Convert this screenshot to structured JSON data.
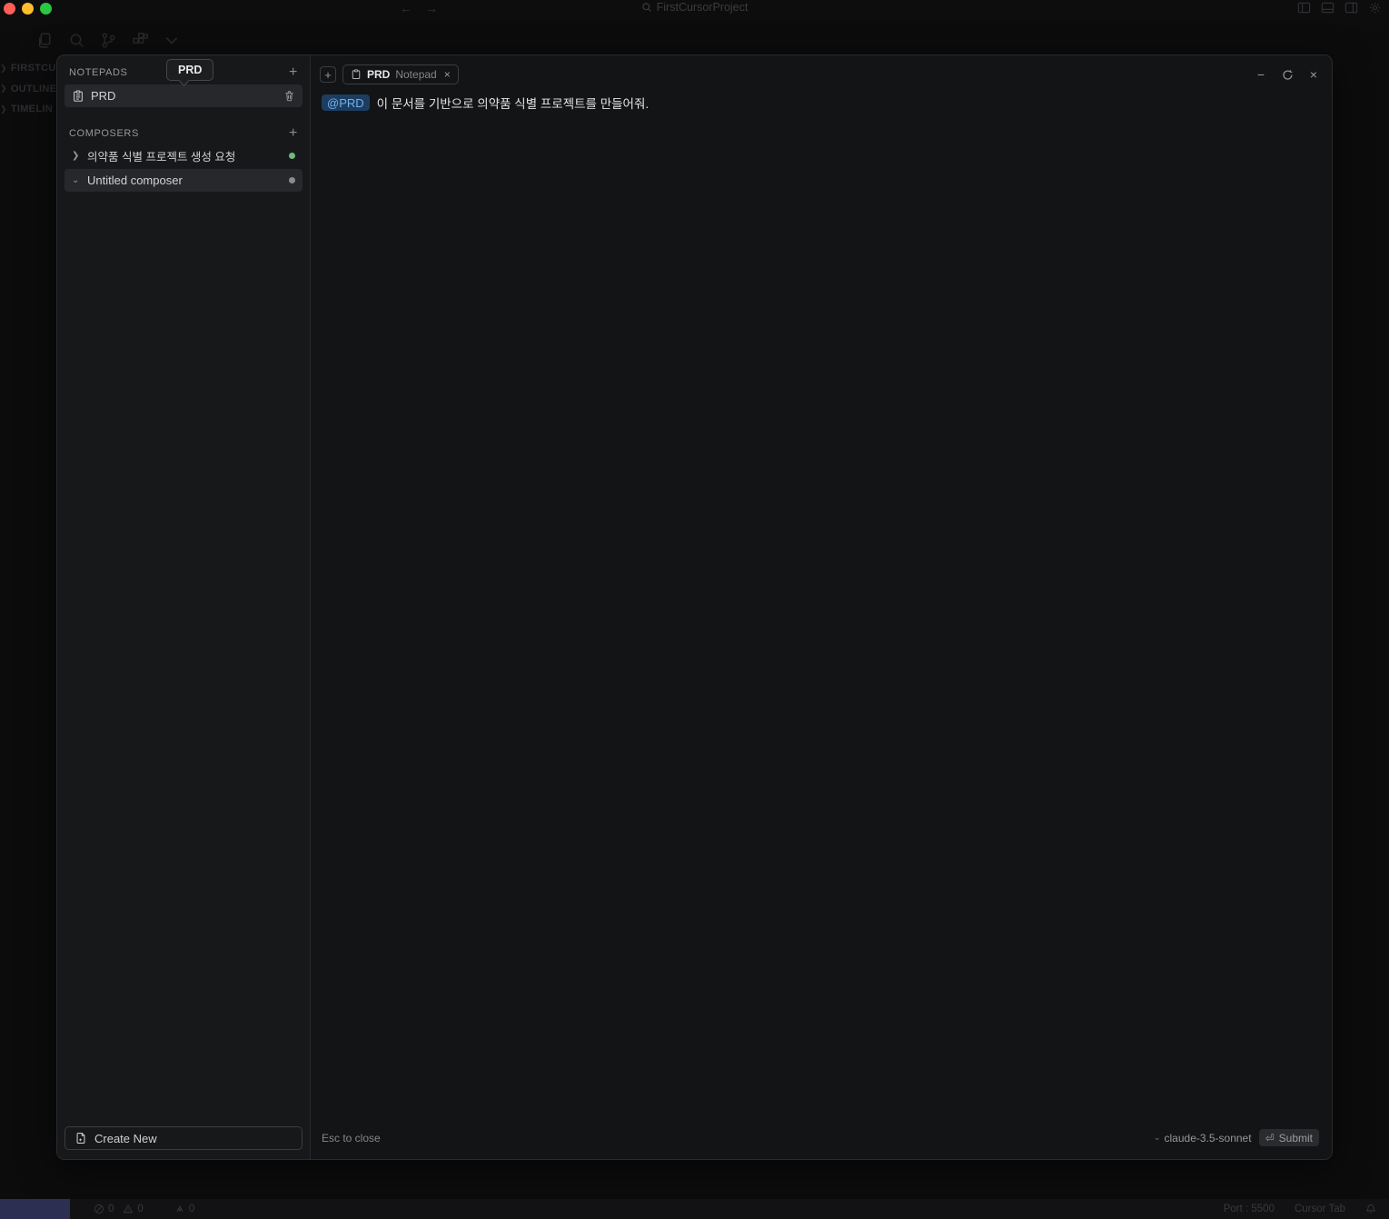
{
  "window": {
    "title": "FirstCursorProject"
  },
  "explorer_ghost": {
    "sections": [
      {
        "label": "FIRSTCU"
      },
      {
        "label": "OUTLINE"
      },
      {
        "label": "TIMELIN"
      }
    ]
  },
  "overlay": {
    "tooltip": "PRD",
    "notepads": {
      "header": "NOTEPADS",
      "add_label": "+",
      "items": [
        {
          "label": "PRD"
        }
      ]
    },
    "composers": {
      "header": "COMPOSERS",
      "add_label": "+",
      "items": [
        {
          "label": "의약품 식별 프로젝트 생성 요청",
          "status_dot": "green"
        },
        {
          "label": "Untitled composer",
          "status_dot": "gray"
        }
      ]
    },
    "create_new_label": "Create New",
    "tab": {
      "add_label": "+",
      "title": "PRD",
      "subtitle": "Notepad",
      "close_label": "×"
    },
    "window_controls": {
      "minimize": "−",
      "close": "×"
    },
    "content": {
      "mention": "@PRD",
      "text": "이 문서를 기반으로 의약품 식별 프로젝트를 만들어줘."
    },
    "footer": {
      "esc_hint": "Esc to close",
      "model": "claude-3.5-sonnet",
      "submit_label": "Submit",
      "submit_key": "⏎"
    }
  },
  "statusbar": {
    "error_count": "0",
    "warning_count": "0",
    "extra_count": "0",
    "port_label": "Port : 5500",
    "cursor_tab_label": "Cursor Tab"
  },
  "colors": {
    "traffic_red": "#ff5f57",
    "traffic_yellow": "#febc2e",
    "traffic_green": "#28c840",
    "composer_dot_green": "#6fb97c",
    "composer_dot_gray": "#8b8c8f",
    "mention_bg": "#1d3d60",
    "mention_text": "#6fb2f1",
    "remote_chip": "#2c2e52",
    "panel_bg": "#141517",
    "row_highlight": "#26282b"
  }
}
